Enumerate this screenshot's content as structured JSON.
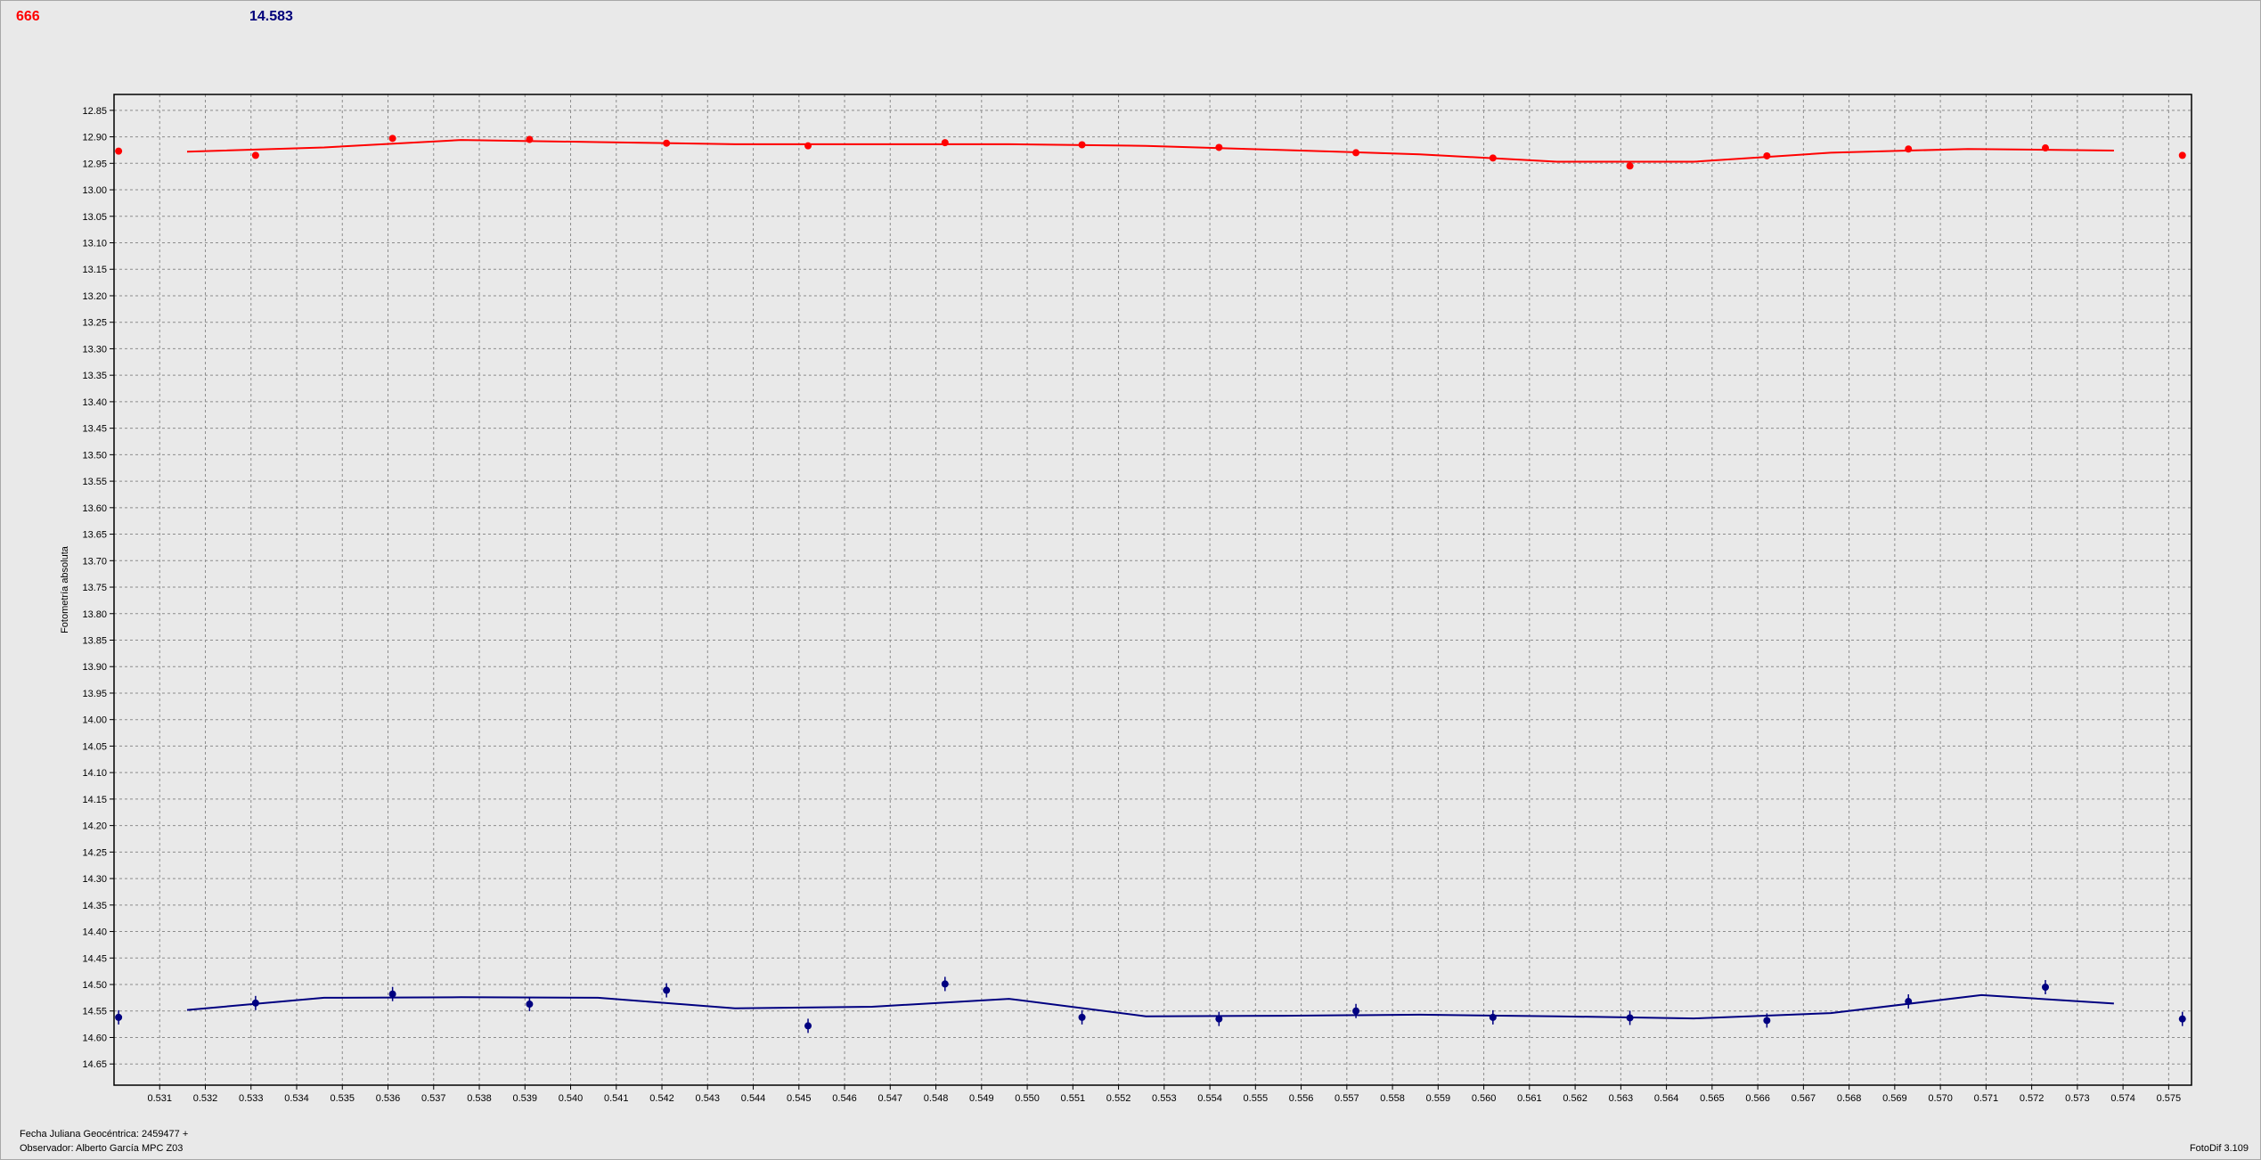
{
  "header": {
    "left_value": "666",
    "right_value": "14.583"
  },
  "footer": {
    "julian_date_label": "Fecha Juliana Geocéntrica: 2459477 +",
    "observer_label": "Observador: Alberto García MPC Z03",
    "version_label": "FotoDif 3.109"
  },
  "colors": {
    "series1": "#ff0000",
    "series2": "#000080",
    "plot_bg": "#e9e9e9",
    "grid": "#8c8c8c"
  },
  "chart_data": {
    "type": "scatter",
    "ylabel": "Fotometría absoluta",
    "xlabel": "",
    "xlim": [
      0.53,
      0.5755
    ],
    "ylim": [
      12.82,
      14.69
    ],
    "y_inverted": true,
    "grid": true,
    "x_ticks": [
      0.531,
      0.532,
      0.533,
      0.534,
      0.535,
      0.536,
      0.537,
      0.538,
      0.539,
      0.54,
      0.541,
      0.542,
      0.543,
      0.544,
      0.545,
      0.546,
      0.547,
      0.548,
      0.549,
      0.55,
      0.551,
      0.552,
      0.553,
      0.554,
      0.555,
      0.556,
      0.557,
      0.558,
      0.559,
      0.56,
      0.561,
      0.562,
      0.563,
      0.564,
      0.565,
      0.566,
      0.567,
      0.568,
      0.569,
      0.57,
      0.571,
      0.572,
      0.573,
      0.574,
      0.575
    ],
    "y_ticks": [
      12.85,
      12.9,
      12.95,
      13.0,
      13.05,
      13.1,
      13.15,
      13.2,
      13.25,
      13.3,
      13.35,
      13.4,
      13.45,
      13.5,
      13.55,
      13.6,
      13.65,
      13.7,
      13.75,
      13.8,
      13.85,
      13.9,
      13.95,
      14.0,
      14.05,
      14.1,
      14.15,
      14.2,
      14.25,
      14.3,
      14.35,
      14.4,
      14.45,
      14.5,
      14.55,
      14.6,
      14.65
    ],
    "series": [
      {
        "points": [
          {
            "x": 0.5301,
            "y": 12.927
          },
          {
            "x": 0.5331,
            "y": 12.935
          },
          {
            "x": 0.5361,
            "y": 12.903
          },
          {
            "x": 0.5391,
            "y": 12.905
          },
          {
            "x": 0.5421,
            "y": 12.912
          },
          {
            "x": 0.5452,
            "y": 12.917
          },
          {
            "x": 0.5482,
            "y": 12.911
          },
          {
            "x": 0.5512,
            "y": 12.915
          },
          {
            "x": 0.5542,
            "y": 12.92
          },
          {
            "x": 0.5572,
            "y": 12.93
          },
          {
            "x": 0.5602,
            "y": 12.94
          },
          {
            "x": 0.5632,
            "y": 12.955
          },
          {
            "x": 0.5662,
            "y": 12.936
          },
          {
            "x": 0.5693,
            "y": 12.923
          },
          {
            "x": 0.5723,
            "y": 12.921
          },
          {
            "x": 0.5753,
            "y": 12.935
          }
        ],
        "fit": [
          {
            "x": 0.5316,
            "y": 12.928
          },
          {
            "x": 0.5346,
            "y": 12.92
          },
          {
            "x": 0.5376,
            "y": 12.906
          },
          {
            "x": 0.5406,
            "y": 12.91
          },
          {
            "x": 0.5436,
            "y": 12.914
          },
          {
            "x": 0.5466,
            "y": 12.914
          },
          {
            "x": 0.5496,
            "y": 12.914
          },
          {
            "x": 0.5526,
            "y": 12.917
          },
          {
            "x": 0.5556,
            "y": 12.925
          },
          {
            "x": 0.5586,
            "y": 12.933
          },
          {
            "x": 0.5616,
            "y": 12.947
          },
          {
            "x": 0.5646,
            "y": 12.947
          },
          {
            "x": 0.5676,
            "y": 12.93
          },
          {
            "x": 0.5706,
            "y": 12.923
          },
          {
            "x": 0.5738,
            "y": 12.926
          }
        ]
      },
      {
        "points": [
          {
            "x": 0.5301,
            "y": 14.562
          },
          {
            "x": 0.5331,
            "y": 14.535
          },
          {
            "x": 0.5361,
            "y": 14.518
          },
          {
            "x": 0.5391,
            "y": 14.537
          },
          {
            "x": 0.5421,
            "y": 14.511
          },
          {
            "x": 0.5452,
            "y": 14.578
          },
          {
            "x": 0.5482,
            "y": 14.499
          },
          {
            "x": 0.5512,
            "y": 14.562
          },
          {
            "x": 0.5542,
            "y": 14.565
          },
          {
            "x": 0.5572,
            "y": 14.55
          },
          {
            "x": 0.5602,
            "y": 14.562
          },
          {
            "x": 0.5632,
            "y": 14.563
          },
          {
            "x": 0.5662,
            "y": 14.568
          },
          {
            "x": 0.5693,
            "y": 14.532
          },
          {
            "x": 0.5723,
            "y": 14.505
          },
          {
            "x": 0.5753,
            "y": 14.565
          }
        ],
        "fit": [
          {
            "x": 0.5316,
            "y": 14.548
          },
          {
            "x": 0.5346,
            "y": 14.525
          },
          {
            "x": 0.5376,
            "y": 14.524
          },
          {
            "x": 0.5406,
            "y": 14.525
          },
          {
            "x": 0.5436,
            "y": 14.545
          },
          {
            "x": 0.5466,
            "y": 14.542
          },
          {
            "x": 0.5496,
            "y": 14.527
          },
          {
            "x": 0.5526,
            "y": 14.56
          },
          {
            "x": 0.5556,
            "y": 14.559
          },
          {
            "x": 0.5586,
            "y": 14.557
          },
          {
            "x": 0.5616,
            "y": 14.56
          },
          {
            "x": 0.5646,
            "y": 14.564
          },
          {
            "x": 0.5676,
            "y": 14.554
          },
          {
            "x": 0.5709,
            "y": 14.52
          },
          {
            "x": 0.5738,
            "y": 14.536
          }
        ]
      }
    ]
  }
}
